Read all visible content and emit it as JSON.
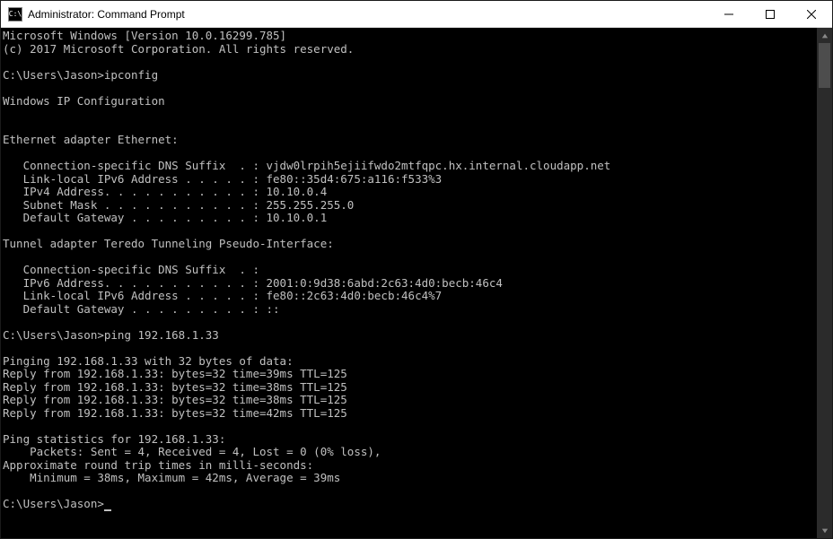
{
  "window": {
    "title": "Administrator: Command Prompt"
  },
  "terminal": {
    "header_line1": "Microsoft Windows [Version 10.0.16299.785]",
    "header_line2": "(c) 2017 Microsoft Corporation. All rights reserved.",
    "prompt1": "C:\\Users\\Jason>ipconfig",
    "ipconfig_title": "Windows IP Configuration",
    "eth_header": "Ethernet adapter Ethernet:",
    "eth_dns": "   Connection-specific DNS Suffix  . : vjdw0lrpih5ejiifwdo2mtfqpc.hx.internal.cloudapp.net",
    "eth_ipv6ll": "   Link-local IPv6 Address . . . . . : fe80::35d4:675:a116:f533%3",
    "eth_ipv4": "   IPv4 Address. . . . . . . . . . . : 10.10.0.4",
    "eth_mask": "   Subnet Mask . . . . . . . . . . . : 255.255.255.0",
    "eth_gw": "   Default Gateway . . . . . . . . . : 10.10.0.1",
    "tun_header": "Tunnel adapter Teredo Tunneling Pseudo-Interface:",
    "tun_dns": "   Connection-specific DNS Suffix  . :",
    "tun_ipv6": "   IPv6 Address. . . . . . . . . . . : 2001:0:9d38:6abd:2c63:4d0:becb:46c4",
    "tun_ipv6ll": "   Link-local IPv6 Address . . . . . : fe80::2c63:4d0:becb:46c4%7",
    "tun_gw": "   Default Gateway . . . . . . . . . : ::",
    "prompt2": "C:\\Users\\Jason>ping 192.168.1.33",
    "ping_header": "Pinging 192.168.1.33 with 32 bytes of data:",
    "ping_r1": "Reply from 192.168.1.33: bytes=32 time=39ms TTL=125",
    "ping_r2": "Reply from 192.168.1.33: bytes=32 time=38ms TTL=125",
    "ping_r3": "Reply from 192.168.1.33: bytes=32 time=38ms TTL=125",
    "ping_r4": "Reply from 192.168.1.33: bytes=32 time=42ms TTL=125",
    "ping_stats1": "Ping statistics for 192.168.1.33:",
    "ping_stats2": "    Packets: Sent = 4, Received = 4, Lost = 0 (0% loss),",
    "ping_rtt1": "Approximate round trip times in milli-seconds:",
    "ping_rtt2": "    Minimum = 38ms, Maximum = 42ms, Average = 39ms",
    "prompt3": "C:\\Users\\Jason>"
  }
}
